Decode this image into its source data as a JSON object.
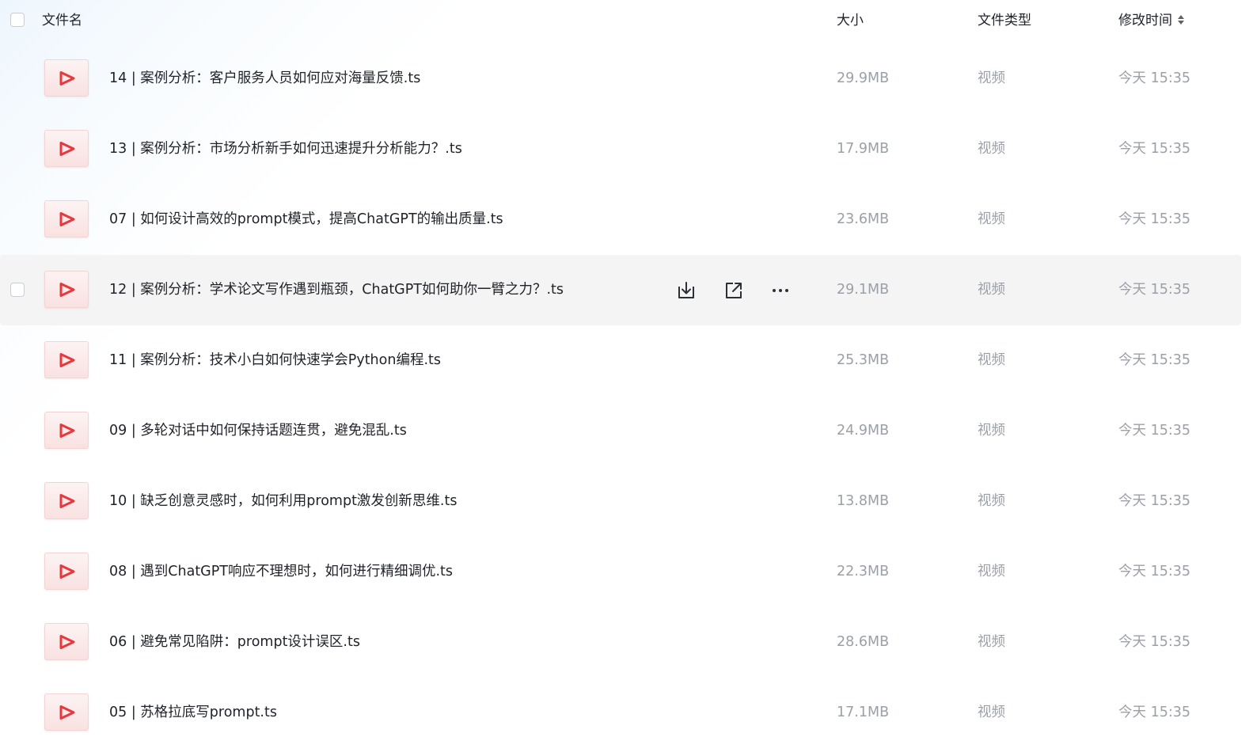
{
  "header": {
    "name_label": "文件名",
    "size_label": "大小",
    "type_label": "文件类型",
    "time_label": "修改时间"
  },
  "colors": {
    "play_icon": "#e8383d",
    "hover_row": "#f4f4f5",
    "muted_text": "#9ba0a8"
  },
  "row_icon": "video-file-icon",
  "row_actions": [
    "download-icon",
    "share-icon",
    "more-icon"
  ],
  "rows": [
    {
      "name": "14 | 案例分析：客户服务人员如何应对海量反馈.ts",
      "size": "29.9MB",
      "type": "视频",
      "modified": "今天 15:35"
    },
    {
      "name": "13 | 案例分析：市场分析新手如何迅速提升分析能力？.ts",
      "size": "17.9MB",
      "type": "视频",
      "modified": "今天 15:35"
    },
    {
      "name": "07 | 如何设计高效的prompt模式，提高ChatGPT的输出质量.ts",
      "size": "23.6MB",
      "type": "视频",
      "modified": "今天 15:35"
    },
    {
      "name": "12 | 案例分析：学术论文写作遇到瓶颈，ChatGPT如何助你一臂之力？.ts",
      "size": "29.1MB",
      "type": "视频",
      "modified": "今天 15:35",
      "hovered": true
    },
    {
      "name": "11 | 案例分析：技术小白如何快速学会Python编程.ts",
      "size": "25.3MB",
      "type": "视频",
      "modified": "今天 15:35"
    },
    {
      "name": "09 | 多轮对话中如何保持话题连贯，避免混乱.ts",
      "size": "24.9MB",
      "type": "视频",
      "modified": "今天 15:35"
    },
    {
      "name": "10 | 缺乏创意灵感时，如何利用prompt激发创新思维.ts",
      "size": "13.8MB",
      "type": "视频",
      "modified": "今天 15:35"
    },
    {
      "name": "08 | 遇到ChatGPT响应不理想时，如何进行精细调优.ts",
      "size": "22.3MB",
      "type": "视频",
      "modified": "今天 15:35"
    },
    {
      "name": "06 | 避免常见陷阱：prompt设计误区.ts",
      "size": "28.6MB",
      "type": "视频",
      "modified": "今天 15:35"
    },
    {
      "name": "05 | 苏格拉底写prompt.ts",
      "size": "17.1MB",
      "type": "视频",
      "modified": "今天 15:35"
    }
  ]
}
